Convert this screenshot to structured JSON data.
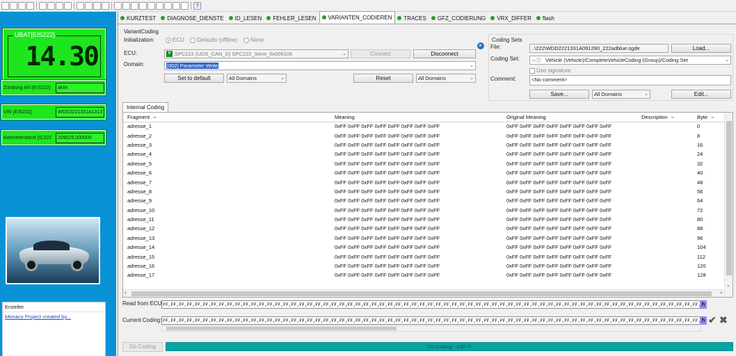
{
  "toolbar": {
    "icons": [
      "new-icon",
      "open-icon",
      "save-icon",
      "save-all-icon",
      "cut-icon",
      "copy-icon",
      "paste-icon",
      "delete-icon",
      "layout-1-icon",
      "layout-2-icon",
      "layout-3-icon",
      "layout-4-icon",
      "tool-1-icon",
      "tool-2-icon",
      "tool-3-icon",
      "tool-4-icon",
      "tool-5-icon",
      "tool-6-icon",
      "tool-7-icon",
      "tool-8-icon",
      "tool-9-icon",
      "help-icon"
    ]
  },
  "left_panel": {
    "ubat": {
      "label": "UBAT[EIS222]",
      "value": "14.30"
    },
    "rows": [
      {
        "label": "Zündung AN [EIS222]",
        "value": "aktiv"
      },
      {
        "label": "VIN [EIS222]",
        "value": "WDD2221331A1313"
      },
      {
        "label": "Kilometerstand [IC222",
        "value": "209029,000000"
      }
    ],
    "creator": {
      "header": "Ersteller",
      "link": "Monaco Project created by..."
    }
  },
  "tabs": [
    "KURZTEST",
    "DIAGNOSE_DIENSTE",
    "ID_LESEN",
    "FEHLER_LESEN",
    "VARIANTEN_CODIEREN",
    "TRACES",
    "GFZ_CODIERUNG",
    "VRX_DIFFER",
    "flash"
  ],
  "active_tab": "VARIANTEN_CODIEREN",
  "variant_coding": {
    "title": "VariantCoding",
    "initialization_label": "Initialization:",
    "radio_ecu": "ECU",
    "radio_defaults": "Defaults (offline)",
    "radio_none": "None",
    "ecu_label": "ECU:",
    "ecu_value": "SPC222 (UDS_CAN_D) SPC222_Serie_0x006106",
    "ecu_badge": "V",
    "connect": "Connect",
    "disconnect": "Disconnect",
    "domain_label": "Domain:",
    "domain_value": "[002] Parameter Write",
    "set_default": "Set to default",
    "all_domains_1": "All Domains",
    "reset": "Reset",
    "all_domains_2": "All Domains"
  },
  "coding_sets": {
    "title": "Coding Sets",
    "file_label": "File:",
    "file_value": "..\\222\\WDD2221331A091290_222adblue.sgde",
    "load": "Load...",
    "set_label": "Coding Set:",
    "set_value": "Vehicle (Vehicle)/CompleteVehicleCoding (Group)/Coding Set",
    "use_signature": "Use signature",
    "comment_label": "Comment:",
    "comment_value": "<No comment>",
    "save": "Save...",
    "all_domains": "All Domains",
    "edit": "Edit..."
  },
  "internal_coding_tab": "Internal Coding",
  "grid": {
    "columns": [
      "Fragment",
      "Meaning",
      "Original Meaning",
      "Description",
      "Byte"
    ],
    "rows": [
      [
        "adresse_1",
        "0xFF 0xFF 0xFF 0xFF 0xFF 0xFF 0xFF 0xFF",
        "0xFF 0xFF 0xFF 0xFF 0xFF 0xFF 0xFF 0xFF",
        "",
        "0"
      ],
      [
        "adresse_2",
        "0xFF 0xFF 0xFF 0xFF 0xFF 0xFF 0xFF 0xFF",
        "0xFF 0xFF 0xFF 0xFF 0xFF 0xFF 0xFF 0xFF",
        "",
        "8"
      ],
      [
        "adresse_3",
        "0xFF 0xFF 0xFF 0xFF 0xFF 0xFF 0xFF 0xFF",
        "0xFF 0xFF 0xFF 0xFF 0xFF 0xFF 0xFF 0xFF",
        "",
        "16"
      ],
      [
        "adresse_4",
        "0xFF 0xFF 0xFF 0xFF 0xFF 0xFF 0xFF 0xFF",
        "0xFF 0xFF 0xFF 0xFF 0xFF 0xFF 0xFF 0xFF",
        "",
        "24"
      ],
      [
        "adresse_5",
        "0xFF 0xFF 0xFF 0xFF 0xFF 0xFF 0xFF 0xFF",
        "0xFF 0xFF 0xFF 0xFF 0xFF 0xFF 0xFF 0xFF",
        "",
        "32"
      ],
      [
        "adresse_6",
        "0xFF 0xFF 0xFF 0xFF 0xFF 0xFF 0xFF 0xFF",
        "0xFF 0xFF 0xFF 0xFF 0xFF 0xFF 0xFF 0xFF",
        "",
        "40"
      ],
      [
        "adresse_7",
        "0xFF 0xFF 0xFF 0xFF 0xFF 0xFF 0xFF 0xFF",
        "0xFF 0xFF 0xFF 0xFF 0xFF 0xFF 0xFF 0xFF",
        "",
        "48"
      ],
      [
        "adresse_8",
        "0xFF 0xFF 0xFF 0xFF 0xFF 0xFF 0xFF 0xFF",
        "0xFF 0xFF 0xFF 0xFF 0xFF 0xFF 0xFF 0xFF",
        "",
        "56"
      ],
      [
        "adresse_9",
        "0xFF 0xFF 0xFF 0xFF 0xFF 0xFF 0xFF 0xFF",
        "0xFF 0xFF 0xFF 0xFF 0xFF 0xFF 0xFF 0xFF",
        "",
        "64"
      ],
      [
        "adresse_10",
        "0xFF 0xFF 0xFF 0xFF 0xFF 0xFF 0xFF 0xFF",
        "0xFF 0xFF 0xFF 0xFF 0xFF 0xFF 0xFF 0xFF",
        "",
        "72"
      ],
      [
        "adresse_11",
        "0xFF 0xFF 0xFF 0xFF 0xFF 0xFF 0xFF 0xFF",
        "0xFF 0xFF 0xFF 0xFF 0xFF 0xFF 0xFF 0xFF",
        "",
        "80"
      ],
      [
        "adresse_12",
        "0xFF 0xFF 0xFF 0xFF 0xFF 0xFF 0xFF 0xFF",
        "0xFF 0xFF 0xFF 0xFF 0xFF 0xFF 0xFF 0xFF",
        "",
        "88"
      ],
      [
        "adresse_13",
        "0xFF 0xFF 0xFF 0xFF 0xFF 0xFF 0xFF 0xFF",
        "0xFF 0xFF 0xFF 0xFF 0xFF 0xFF 0xFF 0xFF",
        "",
        "96"
      ],
      [
        "adresse_14",
        "0xFF 0xFF 0xFF 0xFF 0xFF 0xFF 0xFF 0xFF",
        "0xFF 0xFF 0xFF 0xFF 0xFF 0xFF 0xFF 0xFF",
        "",
        "104"
      ],
      [
        "adresse_15",
        "0xFF 0xFF 0xFF 0xFF 0xFF 0xFF 0xFF 0xFF",
        "0xFF 0xFF 0xFF 0xFF 0xFF 0xFF 0xFF 0xFF",
        "",
        "112"
      ],
      [
        "adresse_16",
        "0xFF 0xFF 0xFF 0xFF 0xFF 0xFF 0xFF 0xFF",
        "0xFF 0xFF 0xFF 0xFF 0xFF 0xFF 0xFF 0xFF",
        "",
        "120"
      ],
      [
        "adresse_17",
        "0xFF 0xFF 0xFF 0xFF 0xFF 0xFF 0xFF 0xFF",
        "0xFF 0xFF 0xFF 0xFF 0xFF 0xFF 0xFF 0xFF",
        "",
        "128"
      ]
    ]
  },
  "bottom": {
    "read_label": "Read from ECU:",
    "read_value": "FF,FF,FF,FF,FF,FF,FF,FF,FF,FF,FF,FF,FF,FF,FF,FF,FF,FF,FF,FF,FF,FF,FF,FF,FF,FF,FF,FF,FF,FF,FF,FF,FF,FF,FF,FF,FF,FF,FF,FF,FF,FF,FF,FF,FF,FF,FF,FF,FF,FF,FF,FF,FF,FF,FF,FF,FF,FF,FF,FF,FF,FF,FF,FF,FF,FF,FF,FF,FF,FF,FF,FF,FF,FF,FF,FF,FF,FF,FF,FF,FF,FF,FF,FF,FF,FF,FF,FF,FF,FF,FF,FF,FF,FF",
    "current_label": "Current Coding:",
    "current_value": "FF,FF,FF,FF,FF,FF,FF,FF,FF,FF,FF,FF,FF,FF,FF,FF,FF,FF,FF,FF,FF,FF,FF,FF,FF,FF,FF,FF,FF,FF,FF,FF,FF,FF,FF,FF,FF,FF,FF,FF,FF,FF,FF,FF,FF,FF,FF,FF,FF,FF,FF,FF,FF,FF,FF,FF,FF,FF,FF,FF,FF,FF,FF,FF,FF,FF,FF,FF,FF,FF,FF,FF,FF,FF,FF,FF,FF,FF,FF,FF,FF,FF,FF,FF,FF,FF,FF,FF,FF,FF,FF,FF,FF,FF",
    "hex_btn": "h",
    "do_coding": "Do Coding",
    "progress": "Do Coding - 100 %",
    "progress_value": 1.0
  },
  "colors": {
    "left_bg": "#0a92d6",
    "green": "#1ee61e",
    "progress": "#03a4a4"
  }
}
